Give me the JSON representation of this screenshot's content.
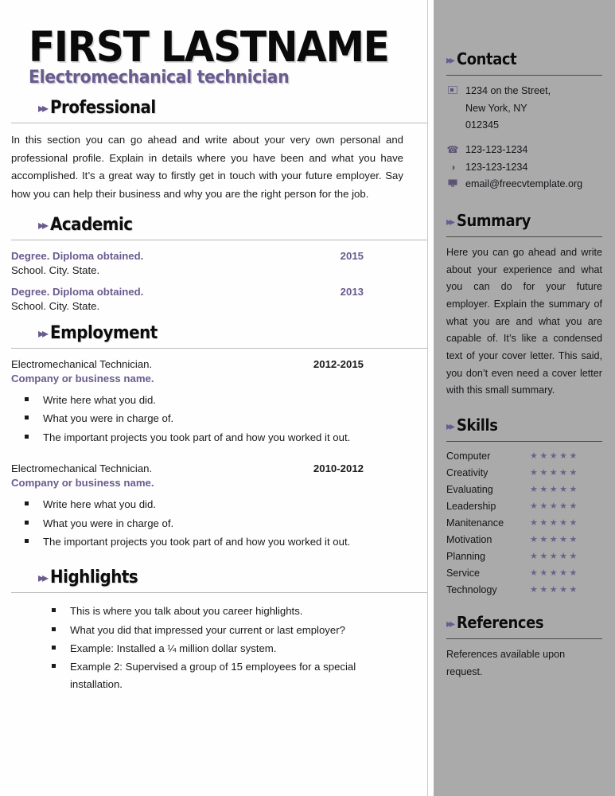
{
  "header": {
    "name": "FIRST LASTNAME",
    "subtitle": "Electromechanical technician"
  },
  "arrow_glyph": "▸▸",
  "colors": {
    "accent_purple": "#6a5b8f",
    "sidebar_bg": "#aaaaaa",
    "text": "#1a1a1a",
    "star": "#6a6289"
  },
  "main": {
    "professional": {
      "title": "Professional",
      "body": "In this section you can go ahead and write about your very own personal and professional profile. Explain in details where you have been and what you have accomplished. It’s a great way to firstly get in touch with your future employer. Say how you can help their business and why you are the right person for the job."
    },
    "academic": {
      "title": "Academic",
      "entries": [
        {
          "degree": "Degree. Diploma obtained.",
          "year": "2015",
          "school": "School. City. State."
        },
        {
          "degree": "Degree. Diploma obtained.",
          "year": "2013",
          "school": "School. City. State."
        }
      ]
    },
    "employment": {
      "title": "Employment",
      "entries": [
        {
          "role": "Electromechanical Technician.",
          "dates": "2012-2015",
          "company": "Company or business name.",
          "bullets": [
            "Write here what you did.",
            "What you were in charge of.",
            "The important projects you took part of and how you worked it out."
          ]
        },
        {
          "role": "Electromechanical Technician.",
          "dates": "2010-2012",
          "company": "Company or business name.",
          "bullets": [
            "Write here what you did.",
            "What you were in charge of.",
            "The important projects you took part of and how you worked it out."
          ]
        }
      ]
    },
    "highlights": {
      "title": "Highlights",
      "bullets": [
        "This is where you talk about you career highlights.",
        "What you did that impressed your current or last employer?",
        "Example: Installed a ¼ million dollar system.",
        "Example 2: Supervised a group of 15 employees for a special installation."
      ]
    }
  },
  "sidebar": {
    "contact": {
      "title": "Contact",
      "address_icon": "address-card-icon",
      "address_lines": [
        "1234 on the Street,",
        "New York, NY",
        "012345"
      ],
      "rows": [
        {
          "icon": "telephone-icon",
          "glyph": "☎",
          "value": "123-123-1234"
        },
        {
          "icon": "mobile-phone-icon",
          "glyph": "◑",
          "value": "123-123-1234"
        },
        {
          "icon": "computer-monitor-icon",
          "glyph": "⎕",
          "value": "email@freecvtemplate.org"
        }
      ]
    },
    "summary": {
      "title": "Summary",
      "body": "Here you can go ahead and write about your experience and what you can do for your future employer. Explain the summary of what you are and what you are capable of. It’s like a condensed text of your cover letter. This said, you don’t even need a cover letter with this small summary."
    },
    "skills": {
      "title": "Skills",
      "star_glyph": "★★★★★",
      "items": [
        {
          "name": "Computer",
          "rating": 5
        },
        {
          "name": "Creativity",
          "rating": 5
        },
        {
          "name": "Evaluating",
          "rating": 5
        },
        {
          "name": "Leadership",
          "rating": 5
        },
        {
          "name": "Manitenance",
          "rating": 5
        },
        {
          "name": "Motivation",
          "rating": 5
        },
        {
          "name": "Planning",
          "rating": 5
        },
        {
          "name": "Service",
          "rating": 5
        },
        {
          "name": "Technology",
          "rating": 5
        }
      ]
    },
    "references": {
      "title": "References",
      "body": "References available upon request."
    }
  }
}
